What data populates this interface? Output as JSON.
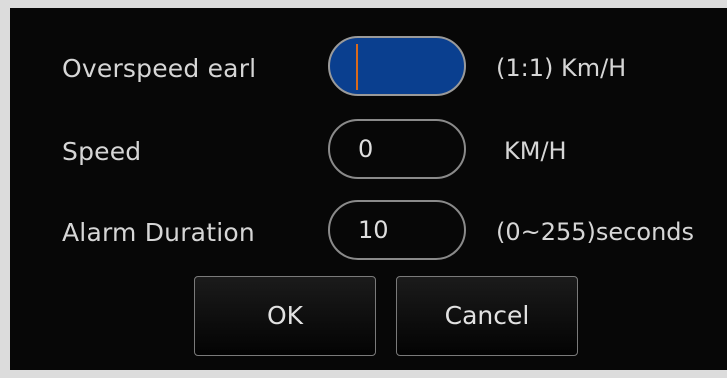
{
  "rows": [
    {
      "label": "Overspeed earl",
      "value": "",
      "unit": "(1:1) Km/H",
      "active": true
    },
    {
      "label": "Speed",
      "value": "0",
      "unit": "KM/H",
      "active": false
    },
    {
      "label": "Alarm Duration",
      "value": "10",
      "unit": "(0~255)seconds",
      "active": false
    }
  ],
  "buttons": {
    "ok": "OK",
    "cancel": "Cancel"
  },
  "colors": {
    "dialog_bg": "#070707",
    "active_field": "#0a3f8f",
    "caret": "#d96a1c",
    "text": "#d6d6d6"
  }
}
